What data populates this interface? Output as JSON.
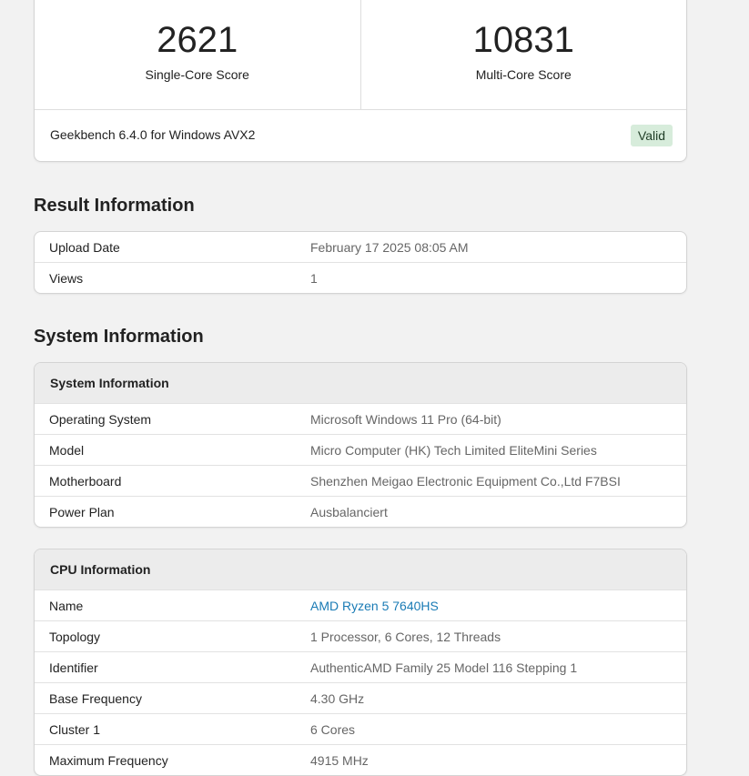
{
  "scores": {
    "single_core": {
      "value": "2621",
      "label": "Single-Core Score"
    },
    "multi_core": {
      "value": "10831",
      "label": "Multi-Core Score"
    }
  },
  "version": {
    "text": "Geekbench 6.4.0 for Windows AVX2",
    "badge": "Valid",
    "badge_color": "#d7ecdb"
  },
  "result_information": {
    "heading": "Result Information",
    "rows": [
      {
        "key": "Upload Date",
        "value": "February 17 2025 08:05 AM"
      },
      {
        "key": "Views",
        "value": "1"
      }
    ]
  },
  "system_information": {
    "heading": "System Information",
    "system_table": {
      "title": "System Information",
      "rows": [
        {
          "key": "Operating System",
          "value": "Microsoft Windows 11 Pro (64-bit)"
        },
        {
          "key": "Model",
          "value": "Micro Computer (HK) Tech Limited EliteMini Series"
        },
        {
          "key": "Motherboard",
          "value": "Shenzhen Meigao Electronic Equipment Co.,Ltd F7BSI"
        },
        {
          "key": "Power Plan",
          "value": "Ausbalanciert"
        }
      ]
    },
    "cpu_table": {
      "title": "CPU Information",
      "rows": [
        {
          "key": "Name",
          "value": "AMD Ryzen 5 7640HS",
          "link": true
        },
        {
          "key": "Topology",
          "value": "1 Processor, 6 Cores, 12 Threads"
        },
        {
          "key": "Identifier",
          "value": "AuthenticAMD Family 25 Model 116 Stepping 1"
        },
        {
          "key": "Base Frequency",
          "value": "4.30 GHz"
        },
        {
          "key": "Cluster 1",
          "value": "6 Cores"
        },
        {
          "key": "Maximum Frequency",
          "value": "4915 MHz"
        }
      ]
    }
  },
  "colors": {
    "link": "#1a7bb5",
    "page_background": "#f2f2f2"
  }
}
